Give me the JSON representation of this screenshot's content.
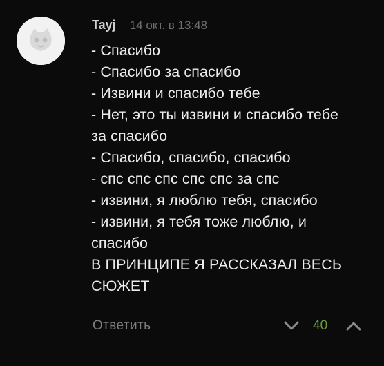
{
  "comment": {
    "username": "Tayj",
    "timestamp": "14 окт. в 13:48",
    "lines": [
      "- Спасибо",
      "- Спасибо за спасибо",
      "- Извини и спасибо тебе",
      "- Нет, это ты извини и спасибо тебе",
      "за спасибо",
      "- Спасибо, спасибо, спасибо",
      "- спс спс спс спс спс за спс",
      "- извини, я люблю тебя, спасибо",
      "- извини, я тебя тоже люблю, и",
      "спасибо",
      "В ПРИНЦИПЕ Я РАССКАЗАЛ ВЕСЬ",
      "СЮЖЕТ"
    ]
  },
  "actions": {
    "reply_label": "Ответить",
    "score": "40"
  },
  "icons": {
    "avatar": "default-avatar-icon",
    "vote_down": "chevron-down-icon",
    "vote_up": "chevron-up-icon"
  },
  "colors": {
    "background": "#0b0b0b",
    "score": "#6b9d3d",
    "muted": "#7d7d7d"
  }
}
